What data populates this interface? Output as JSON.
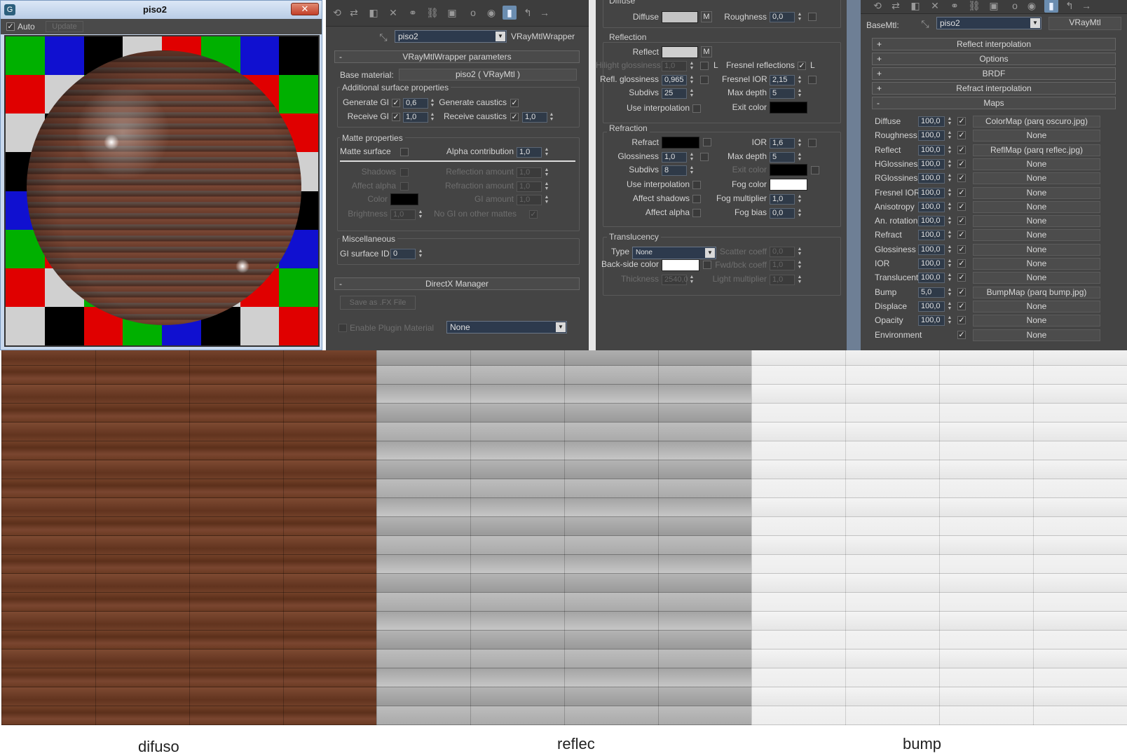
{
  "preview": {
    "title": "piso2",
    "auto_label": "Auto",
    "update_label": "Update"
  },
  "wrapper": {
    "material_name": "piso2",
    "material_type": "VRayMtlWrapper",
    "params_rollout": "VRayMtlWrapper parameters",
    "base_material_label": "Base material:",
    "base_material_value": "piso2  ( VRayMtl )",
    "additional": {
      "title": "Additional surface properties",
      "generate_gi": "Generate GI",
      "generate_gi_val": "0,6",
      "generate_caustics": "Generate caustics",
      "receive_gi": "Receive GI",
      "receive_gi_val": "1,0",
      "receive_caustics": "Receive caustics",
      "receive_caustics_val": "1,0"
    },
    "matte": {
      "title": "Matte properties",
      "matte_surface": "Matte surface",
      "alpha_contribution": "Alpha contribution",
      "alpha_val": "1,0",
      "shadows": "Shadows",
      "reflection_amount": "Reflection amount",
      "refl_val": "1,0",
      "affect_alpha": "Affect alpha",
      "refraction_amount": "Refraction amount",
      "refr_val": "1,0",
      "color": "Color",
      "gi_amount": "GI amount",
      "gi_val": "1,0",
      "brightness": "Brightness",
      "bright_val": "1,0",
      "no_gi": "No GI on other mattes"
    },
    "misc": {
      "title": "Miscellaneous",
      "gi_surface_id": "GI surface ID",
      "gi_id_val": "0"
    },
    "directx": {
      "title": "DirectX Manager",
      "save_fx": "Save as .FX File",
      "enable_plugin": "Enable Plugin Material",
      "plugin_value": "None"
    }
  },
  "vray": {
    "diffuse_group": "Diffuse",
    "diffuse": "Diffuse",
    "m": "M",
    "roughness": "Roughness",
    "roughness_val": "0,0",
    "reflection": {
      "title": "Reflection",
      "reflect": "Reflect",
      "hilight": "Hilight glossiness",
      "hilight_val": "1,0",
      "l": "L",
      "fresnel": "Fresnel reflections",
      "refl_gloss": "Refl. glossiness",
      "refl_gloss_val": "0,965",
      "fresnel_ior": "Fresnel IOR",
      "fresnel_ior_val": "2,15",
      "subdivs": "Subdivs",
      "subdivs_val": "25",
      "max_depth": "Max depth",
      "max_depth_val": "5",
      "use_interp": "Use interpolation",
      "exit_color": "Exit color"
    },
    "refraction": {
      "title": "Refraction",
      "refract": "Refract",
      "ior": "IOR",
      "ior_val": "1,6",
      "glossiness": "Glossiness",
      "gloss_val": "1,0",
      "max_depth": "Max depth",
      "max_depth_val": "5",
      "subdivs": "Subdivs",
      "subdivs_val": "8",
      "exit_color": "Exit color",
      "use_interp": "Use interpolation",
      "fog_color": "Fog color",
      "affect_shadows": "Affect shadows",
      "fog_mult": "Fog multiplier",
      "fog_mult_val": "1,0",
      "affect_alpha": "Affect alpha",
      "fog_bias": "Fog bias",
      "fog_bias_val": "0,0"
    },
    "translucency": {
      "title": "Translucency",
      "type": "Type",
      "type_val": "None",
      "scatter": "Scatter coeff",
      "scatter_val": "0,0",
      "backside": "Back-side color",
      "fwd": "Fwd/bck coeff",
      "fwd_val": "1,0",
      "thickness": "Thickness",
      "thickness_val": "2540,0",
      "light_mult": "Light multiplier",
      "light_val": "1,0"
    }
  },
  "maps": {
    "basemtl_label": "BaseMtl:",
    "material_name": "piso2",
    "material_type": "VRayMtl",
    "rollouts": [
      "Reflect interpolation",
      "Options",
      "BRDF",
      "Refract interpolation"
    ],
    "rollout_signs": [
      "+",
      "+",
      "+",
      "+"
    ],
    "maps_title": "Maps",
    "maps_sign": "-",
    "rows": [
      {
        "name": "Diffuse",
        "amount": "100,0",
        "map": "ColorMap (parq oscuro.jpg)"
      },
      {
        "name": "Roughness",
        "amount": "100,0",
        "map": "None"
      },
      {
        "name": "Reflect",
        "amount": "100,0",
        "map": "ReflMap (parq reflec.jpg)"
      },
      {
        "name": "HGlossiness",
        "amount": "100,0",
        "map": "None"
      },
      {
        "name": "RGlossiness",
        "amount": "100,0",
        "map": "None"
      },
      {
        "name": "Fresnel IOR",
        "amount": "100,0",
        "map": "None"
      },
      {
        "name": "Anisotropy",
        "amount": "100,0",
        "map": "None"
      },
      {
        "name": "An. rotation",
        "amount": "100,0",
        "map": "None"
      },
      {
        "name": "Refract",
        "amount": "100,0",
        "map": "None"
      },
      {
        "name": "Glossiness",
        "amount": "100,0",
        "map": "None"
      },
      {
        "name": "IOR",
        "amount": "100,0",
        "map": "None"
      },
      {
        "name": "Translucent",
        "amount": "100,0",
        "map": "None"
      },
      {
        "name": "Bump",
        "amount": "5,0",
        "map": "BumpMap (parq  bump.jpg)"
      },
      {
        "name": "Displace",
        "amount": "100,0",
        "map": "None"
      },
      {
        "name": "Opacity",
        "amount": "100,0",
        "map": "None"
      },
      {
        "name": "Environment",
        "amount": "",
        "map": "None"
      }
    ]
  },
  "captions": {
    "difuso": "difuso",
    "reflec": "reflec",
    "bump": "bump"
  },
  "colors": {
    "panel": "#444444",
    "accent": "#6b8db0",
    "wood": "#6a3a22"
  }
}
